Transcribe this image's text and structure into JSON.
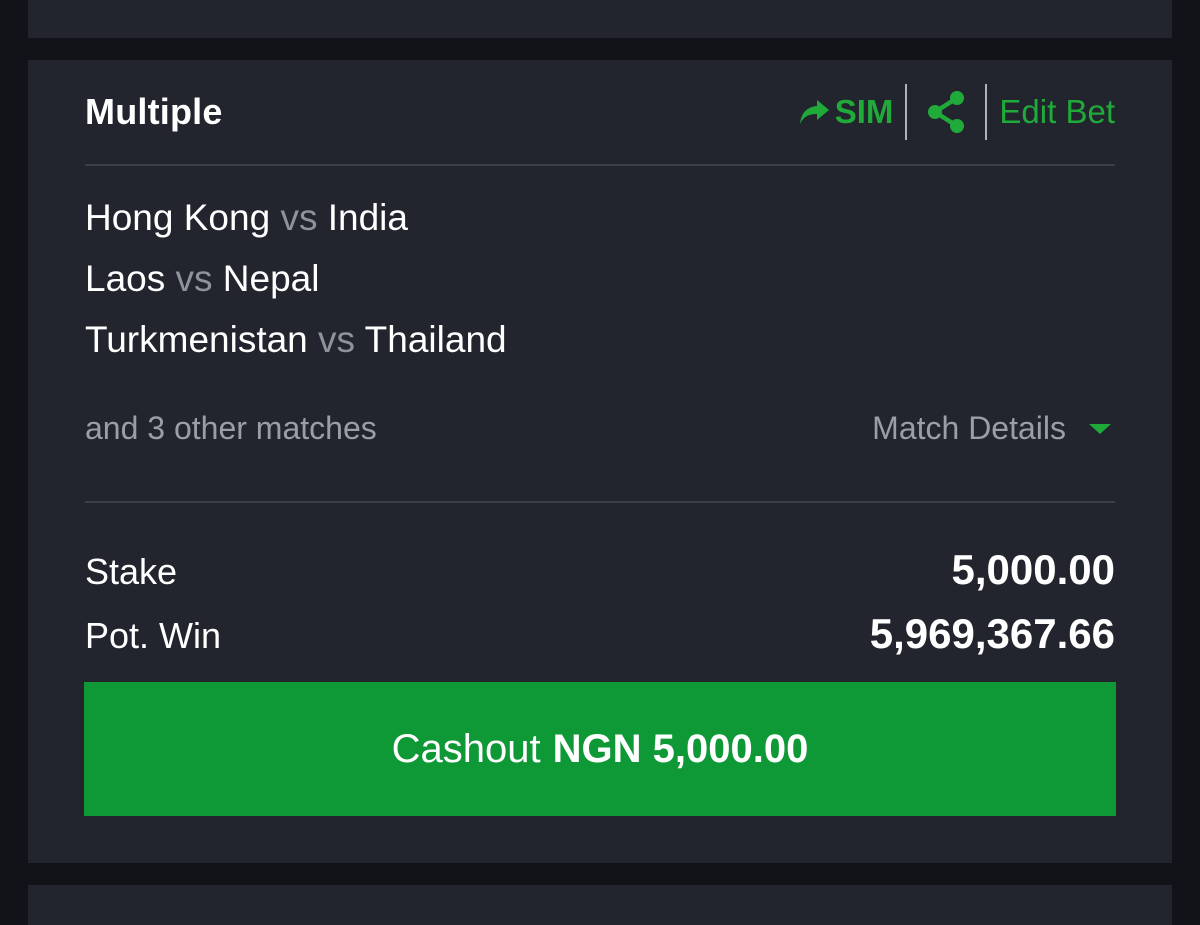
{
  "bet": {
    "title": "Multiple",
    "actions": {
      "sim_label": "SIM",
      "edit_label": "Edit Bet",
      "icons": [
        "share-arrow-icon",
        "share-icon"
      ]
    },
    "matches": [
      {
        "home": "Hong Kong",
        "vs": "vs",
        "away": "India"
      },
      {
        "home": "Laos",
        "vs": "vs",
        "away": "Nepal"
      },
      {
        "home": "Turkmenistan",
        "vs": "vs",
        "away": "Thailand"
      }
    ],
    "others_text": "and 3 other matches",
    "match_details_label": "Match Details",
    "stake_label": "Stake",
    "stake_value": "5,000.00",
    "pot_win_label": "Pot. Win",
    "pot_win_value": "5,969,367.66",
    "cashout_label": "Cashout",
    "cashout_amount": "NGN 5,000.00"
  },
  "colors": {
    "background": "#111318",
    "card": "#22252d",
    "accent_green": "#1faa3a",
    "cashout_green": "#0e9936",
    "muted_text": "#9a9ea7"
  }
}
